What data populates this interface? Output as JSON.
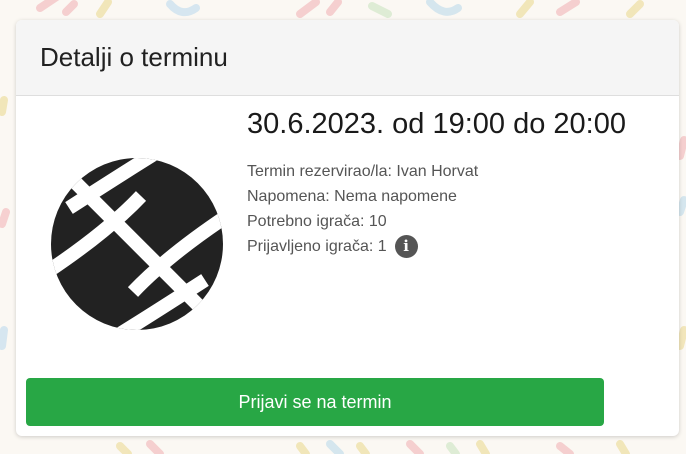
{
  "card": {
    "title": "Detalji o terminu"
  },
  "event": {
    "time": "30.6.2023. od 19:00 do 20:00",
    "icon": "basketball-icon",
    "details": [
      "Termin rezervirao/la: Ivan Horvat",
      "Napomena: Nema napomene",
      "Potrebno igrača: 10",
      "Prijavljeno igrača: 1"
    ],
    "info_icon": "info-circle-icon",
    "info_glyph": "i"
  },
  "actions": {
    "join_label": "Prijavi se na termin"
  },
  "colors": {
    "accent": "#28a745",
    "icon_dark": "#222222",
    "background_pattern": [
      "#f4c9c9",
      "#cfe3ee",
      "#f0e3b0",
      "#d9ebd0"
    ]
  }
}
